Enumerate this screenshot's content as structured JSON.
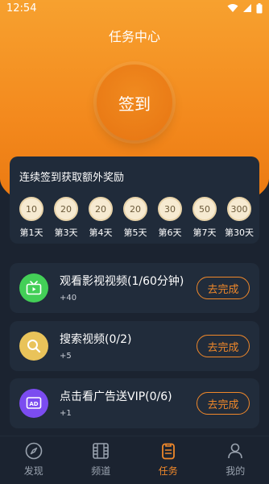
{
  "status_bar": {
    "time": "12:54"
  },
  "header": {
    "title": "任务中心"
  },
  "checkin": {
    "label": "签到"
  },
  "streak": {
    "title": "连续签到获取额外奖励",
    "days": [
      {
        "coins": "10",
        "label": "第1天"
      },
      {
        "coins": "20",
        "label": "第3天"
      },
      {
        "coins": "20",
        "label": "第4天"
      },
      {
        "coins": "20",
        "label": "第5天"
      },
      {
        "coins": "30",
        "label": "第6天"
      },
      {
        "coins": "50",
        "label": "第7天"
      },
      {
        "coins": "300",
        "label": "第30天"
      }
    ]
  },
  "tasks": [
    {
      "title": "观看影视视频(1/60分钟)",
      "reward": "+40",
      "button": "去完成",
      "icon": "tv-icon",
      "color": "#43cf57"
    },
    {
      "title": "搜索视频(0/2)",
      "reward": "+5",
      "button": "去完成",
      "icon": "search-icon",
      "color": "#e9c35a"
    },
    {
      "title": "点击看广告送VIP(0/6)",
      "reward": "+1",
      "button": "去完成",
      "icon": "ad-icon",
      "color": "#7b4cf0"
    }
  ],
  "tabbar": {
    "items": [
      {
        "label": "发现",
        "icon": "compass-icon",
        "active": false
      },
      {
        "label": "频道",
        "icon": "film-icon",
        "active": false
      },
      {
        "label": "任务",
        "icon": "clipboard-icon",
        "active": true
      },
      {
        "label": "我的",
        "icon": "user-icon",
        "active": false
      }
    ]
  },
  "colors": {
    "accent": "#f0882a",
    "background": "#1b2330",
    "card": "#212c3b"
  }
}
